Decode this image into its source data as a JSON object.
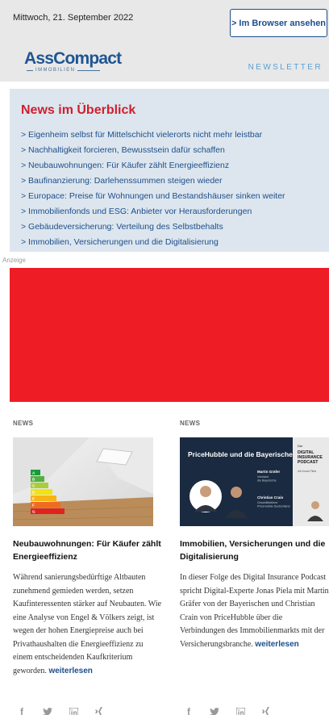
{
  "header": {
    "date": "Mittwoch, 21. September 2022",
    "browser_button": "> Im Browser ansehen",
    "logo_main": "AssCompact",
    "logo_sub": "IMMOBILIEN",
    "newsletter_label": "NEWSLETTER"
  },
  "overview": {
    "title": "News im Überblick",
    "items": [
      "> Eigenheim selbst für Mittelschicht vielerorts nicht mehr leistbar",
      "> Nachhaltigkeit forcieren, Bewusstsein dafür schaffen",
      "> Neubauwohnungen: Für Käufer zählt Energieeffizienz",
      "> Baufinanzierung: Darlehenssummen steigen wieder",
      "> Europace: Preise für Wohnungen und Bestandshäuser sinken weiter",
      "> Immobilienfonds und ESG: Anbieter vor Herausforderungen",
      "> Gebäudeversicherung: Verteilung des Selbstbehalts",
      "> Immobilien, Versicherungen und die Digitalisierung"
    ]
  },
  "ad": {
    "label": "Anzeige",
    "color": "#ee1c25"
  },
  "articles": [
    {
      "tag": "NEWS",
      "title": "Neubauwohnungen: Für Käufer zählt Energieeffizienz",
      "text": "Während sanierungsbedürftige Altbauten zunehmend gemieden werden, setzen Kaufinteressenten stärker auf Neubauten. Wie eine Analyse von Engel & Völkers zeigt, ist wegen der hohen Energiepreise auch bei Privathaushalten die Energieeffizienz zu einem entscheidenden Kaufkriterium geworden.",
      "more": "weiterlesen",
      "image": {
        "labels": [
          "A",
          "B",
          "C",
          "D",
          "E",
          "F",
          "G"
        ]
      }
    },
    {
      "tag": "NEWS",
      "title": "Immobilien, Versicherungen und die Digitalisierung",
      "text": "In dieser Folge des Digital Insurance Podcast spricht Digital-Experte Jonas Piela mit Martin Gräfer von der Bayerischen und Christian Crain von PriceHubble über die Verbindungen des Immobilienmarkts mit der Versicherungsbranche.",
      "more": "weiterlesen",
      "image": {
        "headline": "PriceHubble und die Bayerische",
        "person1_name": "Martin Gräfer",
        "person1_role": "Vorstand\ndie Bayerische",
        "person2_name": "Christian Crain",
        "person2_role": "Geschäftsführer\nPriceHubble Deutschland",
        "podcast_small": "Der",
        "podcast_title": "DIGITAL\nINSURANCE\nPODCAST",
        "podcast_host": "mit Jonas Piela"
      }
    }
  ],
  "share_icons": [
    "facebook-icon",
    "twitter-icon",
    "linkedin-icon",
    "xing-icon"
  ],
  "colors": {
    "brand_blue": "#1d4e8b",
    "accent_red": "#cf1f2e",
    "overview_bg": "#dde6ee"
  }
}
